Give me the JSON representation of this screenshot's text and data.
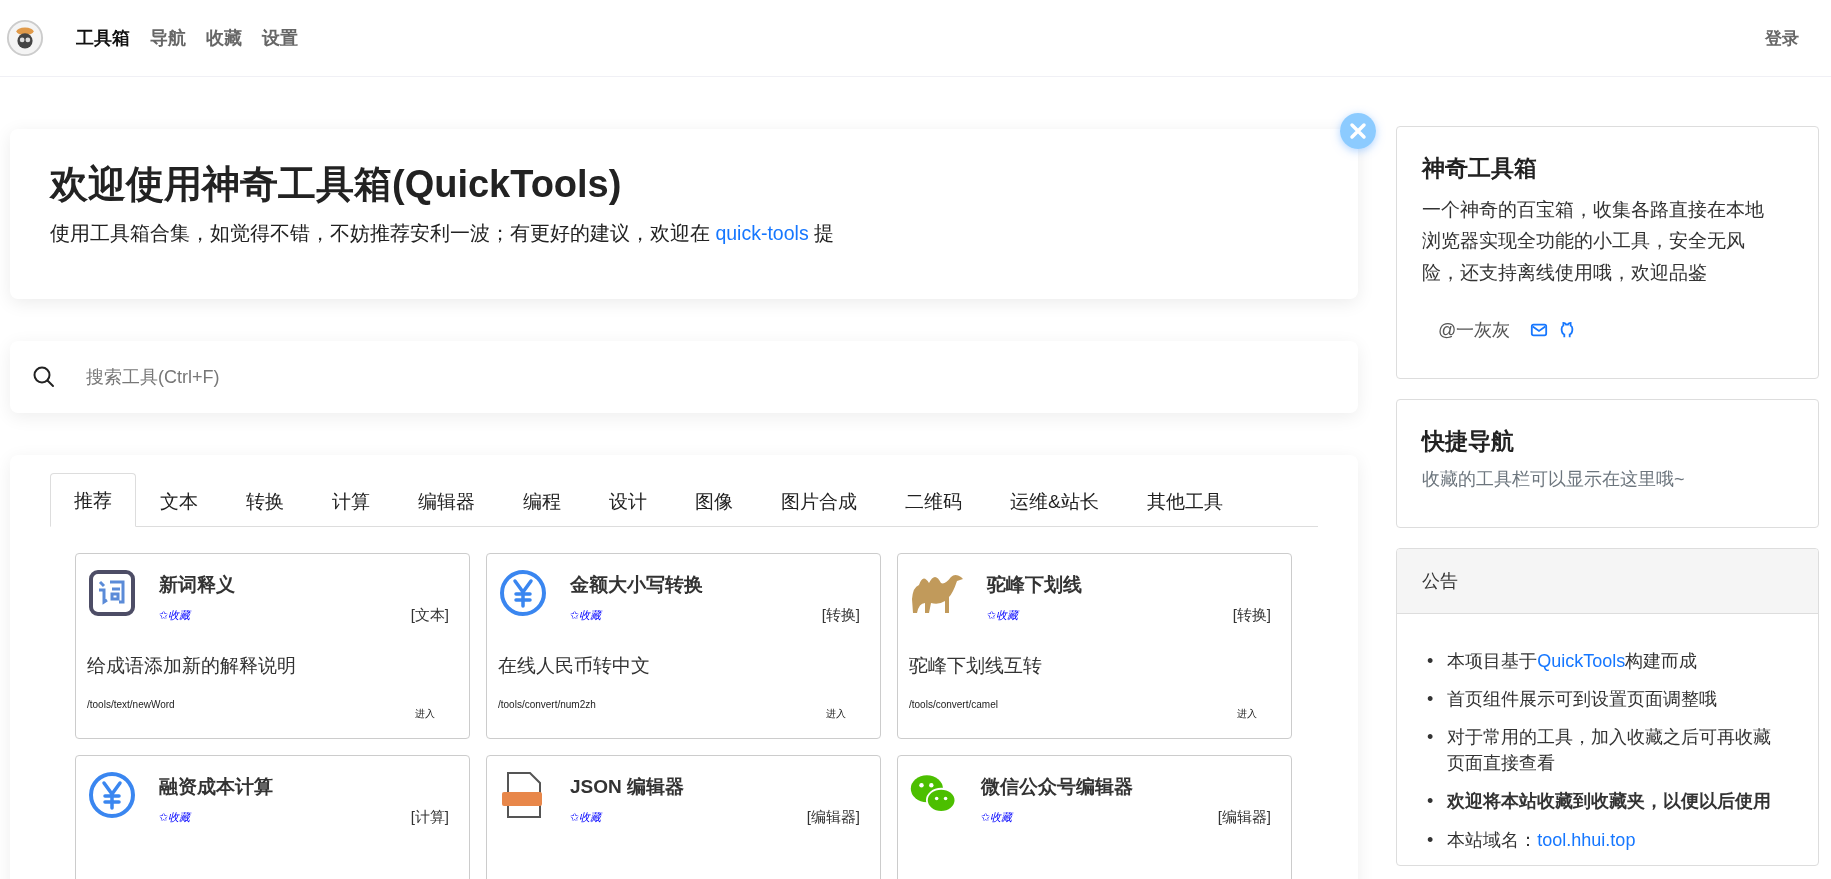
{
  "header": {
    "brand": "工具箱",
    "nav": [
      {
        "label": "导航",
        "selected": false
      },
      {
        "label": "收藏",
        "selected": false
      },
      {
        "label": "设置",
        "selected": false
      }
    ],
    "login": "登录"
  },
  "hero": {
    "title": "欢迎使用神奇工具箱(QuickTools)",
    "text_before": "使用工具箱合集，如觉得不错，不妨推荐安利一波；有更好的建议，欢迎在",
    "link": "quick-tools",
    "text_after": "提"
  },
  "search": {
    "placeholder": "搜索工具(Ctrl+F)"
  },
  "tabs": [
    {
      "label": "推荐",
      "selected": true
    },
    {
      "label": "文本",
      "selected": false
    },
    {
      "label": "转换",
      "selected": false
    },
    {
      "label": "计算",
      "selected": false
    },
    {
      "label": "编辑器",
      "selected": false
    },
    {
      "label": "编程",
      "selected": false
    },
    {
      "label": "设计",
      "selected": false
    },
    {
      "label": "图像",
      "selected": false
    },
    {
      "label": "图片合成",
      "selected": false
    },
    {
      "label": "二维码",
      "selected": false
    },
    {
      "label": "运维&站长",
      "selected": false
    },
    {
      "label": "其他工具",
      "selected": false
    }
  ],
  "tools": [
    {
      "kind": "dictionary",
      "name": "新词释义",
      "favorite": "✩收藏",
      "category": "[文本]",
      "description": "给成语添加新的解释说明",
      "path": "/tools/text/newWord",
      "enter": "进入"
    },
    {
      "kind": "yen",
      "name": "金额大小写转换",
      "favorite": "✩收藏",
      "category": "[转换]",
      "description": "在线人民币转中文",
      "path": "/tools/convert/num2zh",
      "enter": "进入"
    },
    {
      "kind": "camel",
      "name": "驼峰下划线",
      "favorite": "✩收藏",
      "category": "[转换]",
      "description": "驼峰下划线互转",
      "path": "/tools/convert/camel",
      "enter": "进入"
    },
    {
      "kind": "yen",
      "name": "融资成本计算",
      "favorite": "✩收藏",
      "category": "[计算]"
    },
    {
      "kind": "json",
      "name": "JSON 编辑器",
      "favorite": "✩收藏",
      "category": "[编辑器]"
    },
    {
      "kind": "chat",
      "name": "微信公众号编辑器",
      "favorite": "✩收藏",
      "category": "[编辑器]"
    }
  ],
  "about": {
    "title": "神奇工具箱",
    "text": "一个神奇的百宝箱，收集各路直接在本地浏览器实现全功能的小工具，安全无风险，还支持离线使用哦，欢迎品鉴",
    "author": "@一灰灰"
  },
  "quick_nav": {
    "title": "快捷导航",
    "hint": "收藏的工具栏可以显示在这里哦~"
  },
  "notice": {
    "title": "公告",
    "items": [
      {
        "bullet": "•",
        "text_before": "本项目基于",
        "link": "QuickTools",
        "text_after": "构建而成",
        "bold": false
      },
      {
        "bullet": "•",
        "text_before": "首页组件展示可到设置页面调整哦",
        "bold": false
      },
      {
        "bullet": "•",
        "text_before": "对于常用的工具，加入收藏之后可再收藏页面直接查看",
        "bold": false
      },
      {
        "bullet": "•",
        "text_before": "欢迎将本站收藏到收藏夹，以便以后使用",
        "bold": true
      },
      {
        "bullet": "•",
        "text_before": "本站域名：",
        "link": "tool.hhui.top",
        "bold": false
      }
    ]
  }
}
